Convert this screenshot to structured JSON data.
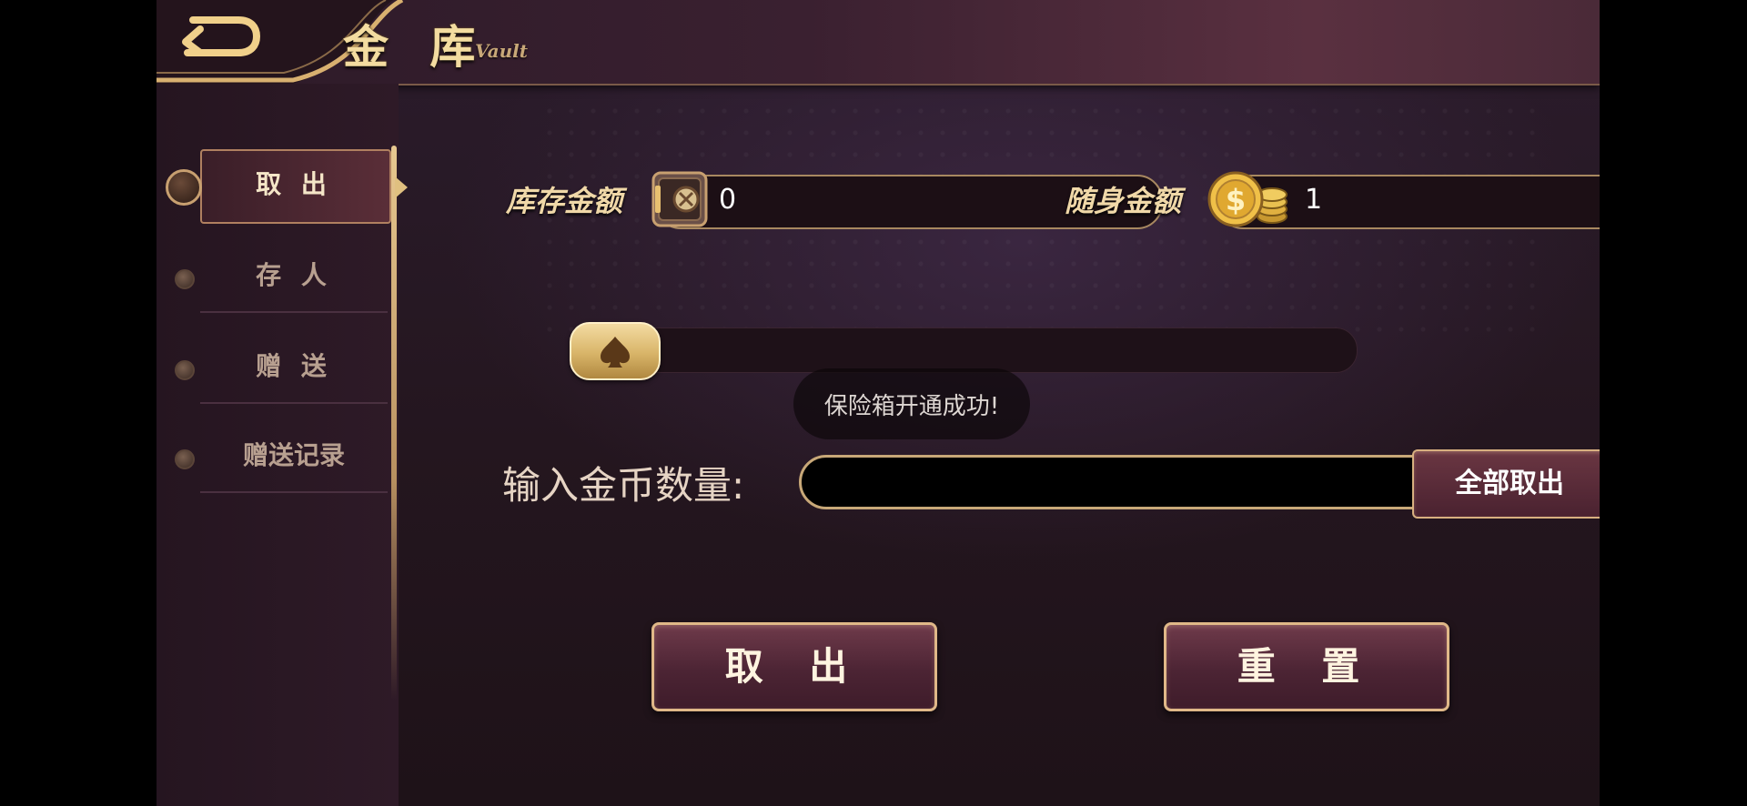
{
  "header": {
    "title_cn": "金 库",
    "title_en": "Vault"
  },
  "sidebar": {
    "items": [
      {
        "label": "取 出",
        "active": true
      },
      {
        "label": "存 人",
        "active": false
      },
      {
        "label": "赠 送",
        "active": false
      },
      {
        "label": "赠送记录",
        "active": false
      }
    ]
  },
  "balances": {
    "vault_label": "库存金额",
    "vault_value": "0",
    "vault_icon": "safe-icon",
    "carry_label": "随身金额",
    "carry_value": "1",
    "carry_icon": "gold-coins-icon"
  },
  "slider": {
    "value_fraction": 0,
    "knob_icon": "spade-icon"
  },
  "toast": {
    "message": "保险箱开通成功!"
  },
  "input": {
    "label": "输入金币数量:",
    "value": "",
    "placeholder": ""
  },
  "buttons": {
    "withdraw_all": "全部取出",
    "withdraw": "取 出",
    "reset": "重 置"
  },
  "colors": {
    "gold": "#f0d8a8",
    "button_border": "#e0b888",
    "background": "#2b1c2c"
  }
}
